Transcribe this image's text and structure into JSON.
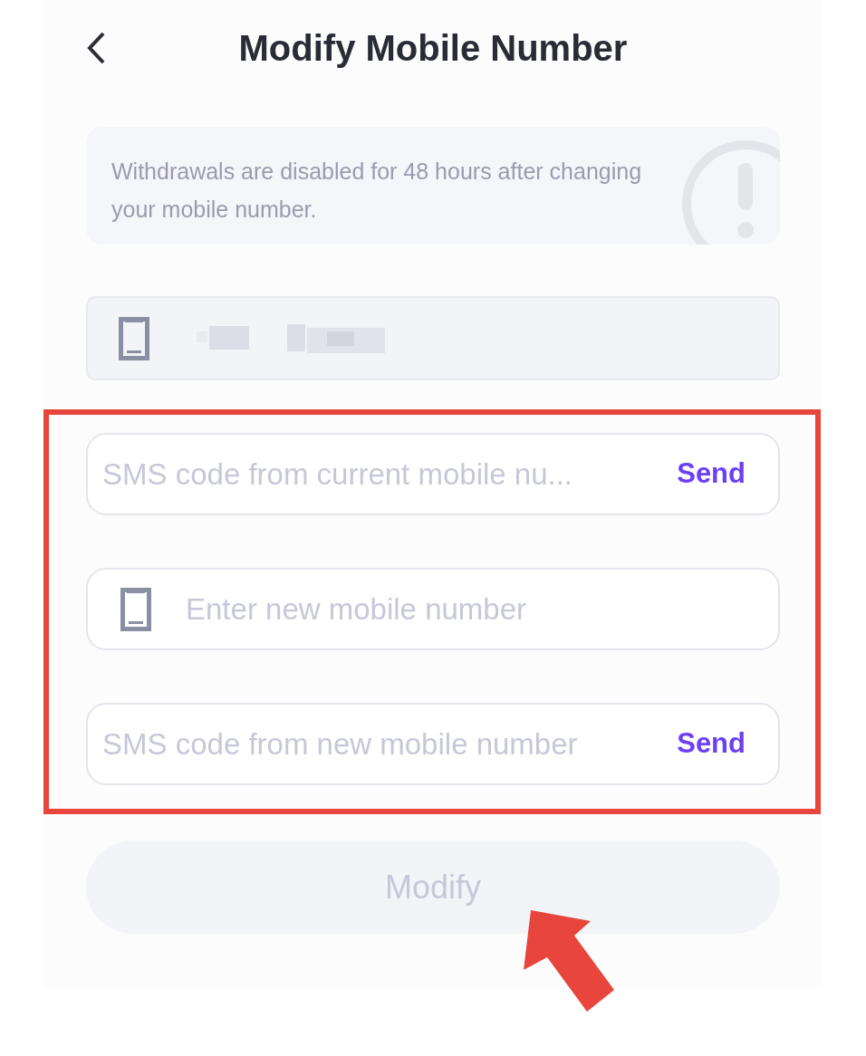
{
  "header": {
    "title": "Modify Mobile Number"
  },
  "notice": {
    "text": "Withdrawals are disabled for 48 hours after changing your mobile number."
  },
  "current_number": {
    "disabled": true
  },
  "fields": [
    {
      "kind": "code",
      "placeholder": "SMS code from current mobile nu...",
      "action": "Send"
    },
    {
      "kind": "phone",
      "placeholder": "Enter new mobile number"
    },
    {
      "kind": "code",
      "placeholder": "SMS code from new mobile number",
      "action": "Send"
    }
  ],
  "submit": {
    "label": "Modify",
    "disabled": true
  }
}
